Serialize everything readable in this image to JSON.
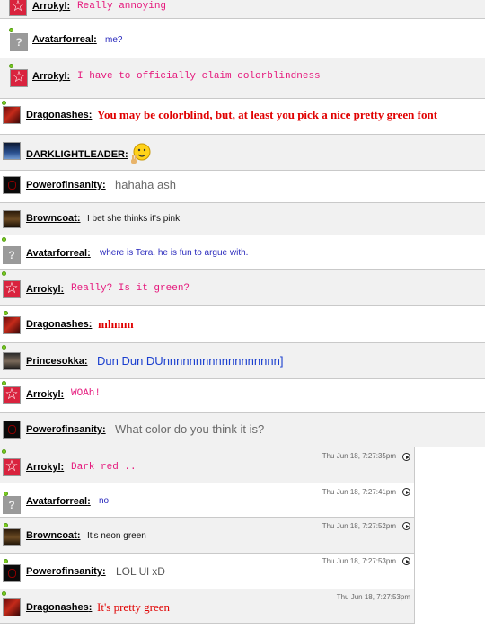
{
  "messages": [
    {
      "user": "Arrokyl",
      "text": "Really annoying",
      "avatar": "star-avatar"
    },
    {
      "user": "Avatarforreal",
      "text": "me?",
      "avatar": "question-avatar"
    },
    {
      "user": "Arrokyl",
      "text": "I have to officially claim colorblindness",
      "avatar": "star-avatar"
    },
    {
      "user": "Dragonashes",
      "text": "You may be colorblind, but, at least you pick a nice pretty green font",
      "avatar": "dragon-avatar"
    },
    {
      "user": "DARKLIGHTLEADER",
      "text": "",
      "avatar": "dark-avatar",
      "emoticon": "peace-smiley-icon"
    },
    {
      "user": "Powerofinsanity",
      "text": "hahaha ash",
      "avatar": "power-avatar"
    },
    {
      "user": "Browncoat",
      "text": "I bet she thinks it's pink",
      "avatar": "brown-avatar"
    },
    {
      "user": "Avatarforreal",
      "text": "where is Tera. he is fun to argue with.",
      "avatar": "question-avatar"
    },
    {
      "user": "Arrokyl",
      "text": "Really? Is it green?",
      "avatar": "star-avatar"
    },
    {
      "user": "Dragonashes",
      "text": "mhmm",
      "avatar": "dragon-avatar"
    },
    {
      "user": "Princesokka",
      "text": "Dun Dun DUnnnnnnnnnnnnnnnnnn]",
      "avatar": "prince-avatar"
    },
    {
      "user": "Arrokyl",
      "text": "WOAh!",
      "avatar": "star-avatar"
    },
    {
      "user": "Powerofinsanity",
      "text": "What color do you think it is?",
      "avatar": "power-avatar"
    },
    {
      "user": "Arrokyl",
      "text": "Dark red ..",
      "avatar": "star-avatar",
      "time": "Thu Jun 18, 7:27:35pm"
    },
    {
      "user": "Avatarforreal",
      "text": "no",
      "avatar": "question-avatar",
      "time": "Thu Jun 18, 7:27:41pm"
    },
    {
      "user": "Browncoat",
      "text": "It's neon green",
      "avatar": "brown-avatar",
      "time": "Thu Jun 18, 7:27:52pm"
    },
    {
      "user": "Powerofinsanity",
      "text": "LOL Ul xD",
      "avatar": "power-avatar",
      "time": "Thu Jun 18, 7:27:53pm"
    },
    {
      "user": "Dragonashes",
      "text": "It's pretty green",
      "avatar": "dragon-avatar",
      "time": "Thu Jun 18, 7:27:53pm"
    }
  ],
  "colors": {
    "arrokyl": "#e5187c",
    "avatarforreal": "#2b2bbd",
    "dragonashes": "#e00000",
    "online_dot": "#7fcf22",
    "row_alt": "#f1f1f1"
  }
}
